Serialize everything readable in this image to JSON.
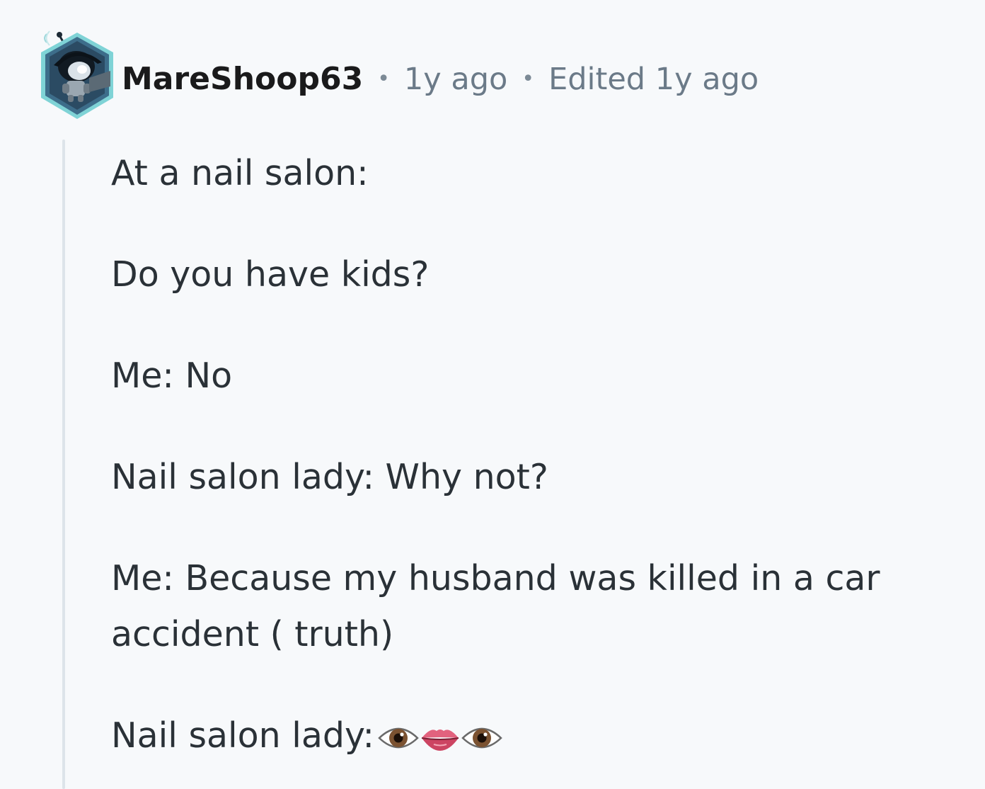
{
  "comment": {
    "username": "MareShoop63",
    "separator": "•",
    "time": "1y ago",
    "edited": "Edited 1y ago",
    "lines": [
      "At a nail salon:",
      "Do you have kids?",
      "Me: No",
      "Nail salon lady: Why not?",
      "Me: Because my husband was killed in a car accident ( truth)",
      "Nail salon lady:"
    ],
    "emojis": [
      "eye-icon",
      "lips-icon",
      "eye-icon"
    ]
  },
  "colors": {
    "background": "#f7f9fb",
    "username": "#1a1a1b",
    "meta": "#6b7a88",
    "body_text": "#2a3137",
    "thread_line": "#dde4ea",
    "avatar_ring": "#7fd3d6",
    "avatar_bg": "#2b4b63"
  }
}
